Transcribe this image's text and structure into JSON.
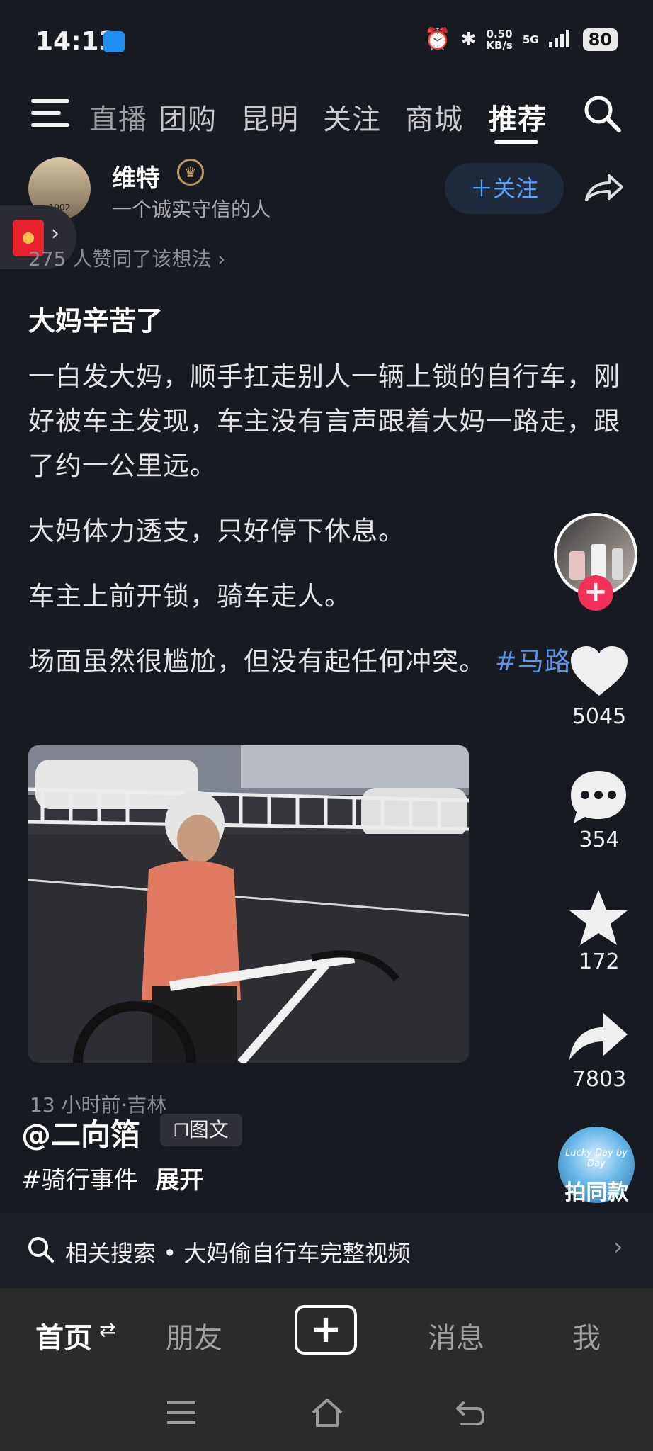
{
  "status": {
    "time": "14:13",
    "net_speed_value": "0.50",
    "net_speed_unit": "KB/s",
    "network": "5G",
    "battery": "80"
  },
  "tabs": [
    {
      "label": "直播",
      "active": false
    },
    {
      "label": "团购",
      "active": false
    },
    {
      "label": "昆明",
      "active": false
    },
    {
      "label": "关注",
      "active": false
    },
    {
      "label": "商城",
      "active": false
    },
    {
      "label": "推荐",
      "active": true
    }
  ],
  "author": {
    "name": "维特",
    "bio": "一个诚实守信的人",
    "avatar_label": "1902",
    "follow_label": "＋关注"
  },
  "agree_text": "275 人赞同了该想法 ›",
  "post": {
    "title": "大妈辛苦了",
    "p1": "一白发大妈，顺手扛走别人一辆上锁的自行车，刚好被车主发现，车主没有言声跟着大妈一路走，跟了约一公里远。",
    "p2": "大妈体力透支，只好停下休息。",
    "p3": "车主上前开锁，骑车走人。",
    "p4": "场面虽然很尴尬，但没有起任何冲突。",
    "hashtag": "#马路故事",
    "meta": "13 小时前·吉林"
  },
  "poster": {
    "name": "@二向箔",
    "type_badge": "图文",
    "tags": "#骑行事件",
    "expand": "展开"
  },
  "sidebar": {
    "likes": "5045",
    "comments": "354",
    "favorites": "172",
    "shares": "7803",
    "music_disc_text": "Lucky Day by Day",
    "same_style": "拍同款"
  },
  "related": {
    "label": "相关搜索",
    "dot": "•",
    "query": "大妈偷自行车完整视频"
  },
  "bottom_nav": {
    "home": "首页",
    "friends": "朋友",
    "create": "+",
    "messages": "消息",
    "me": "我"
  },
  "colors": {
    "accent_blue": "#5aa2ff",
    "hashtag": "#5f93e8",
    "like_plus": "#f2305a",
    "background": "#181a22"
  }
}
